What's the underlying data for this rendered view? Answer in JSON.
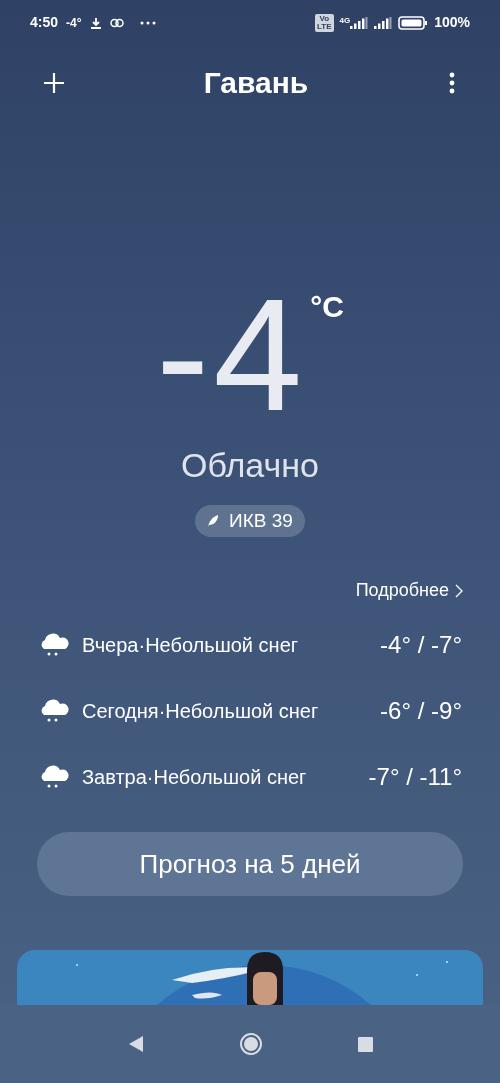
{
  "status_bar": {
    "time": "4:50",
    "temperature": "-4°",
    "network_badge": [
      "Vo",
      "LTE"
    ],
    "network_type": "4G",
    "battery": "100%"
  },
  "header": {
    "title": "Гавань"
  },
  "current": {
    "temperature": "-4",
    "unit": "°C",
    "condition": "Облачно",
    "aqi": "ИКВ 39"
  },
  "forecast": {
    "more_link": "Подробнее",
    "days": [
      {
        "label": "Вчера·Небольшой снег",
        "range": "-4° / -7°"
      },
      {
        "label": "Сегодня·Небольшой снег",
        "range": "-6° / -9°"
      },
      {
        "label": "Завтра·Небольшой снег",
        "range": "-7° / -11°"
      }
    ],
    "button": "Прогноз на 5 дней"
  }
}
